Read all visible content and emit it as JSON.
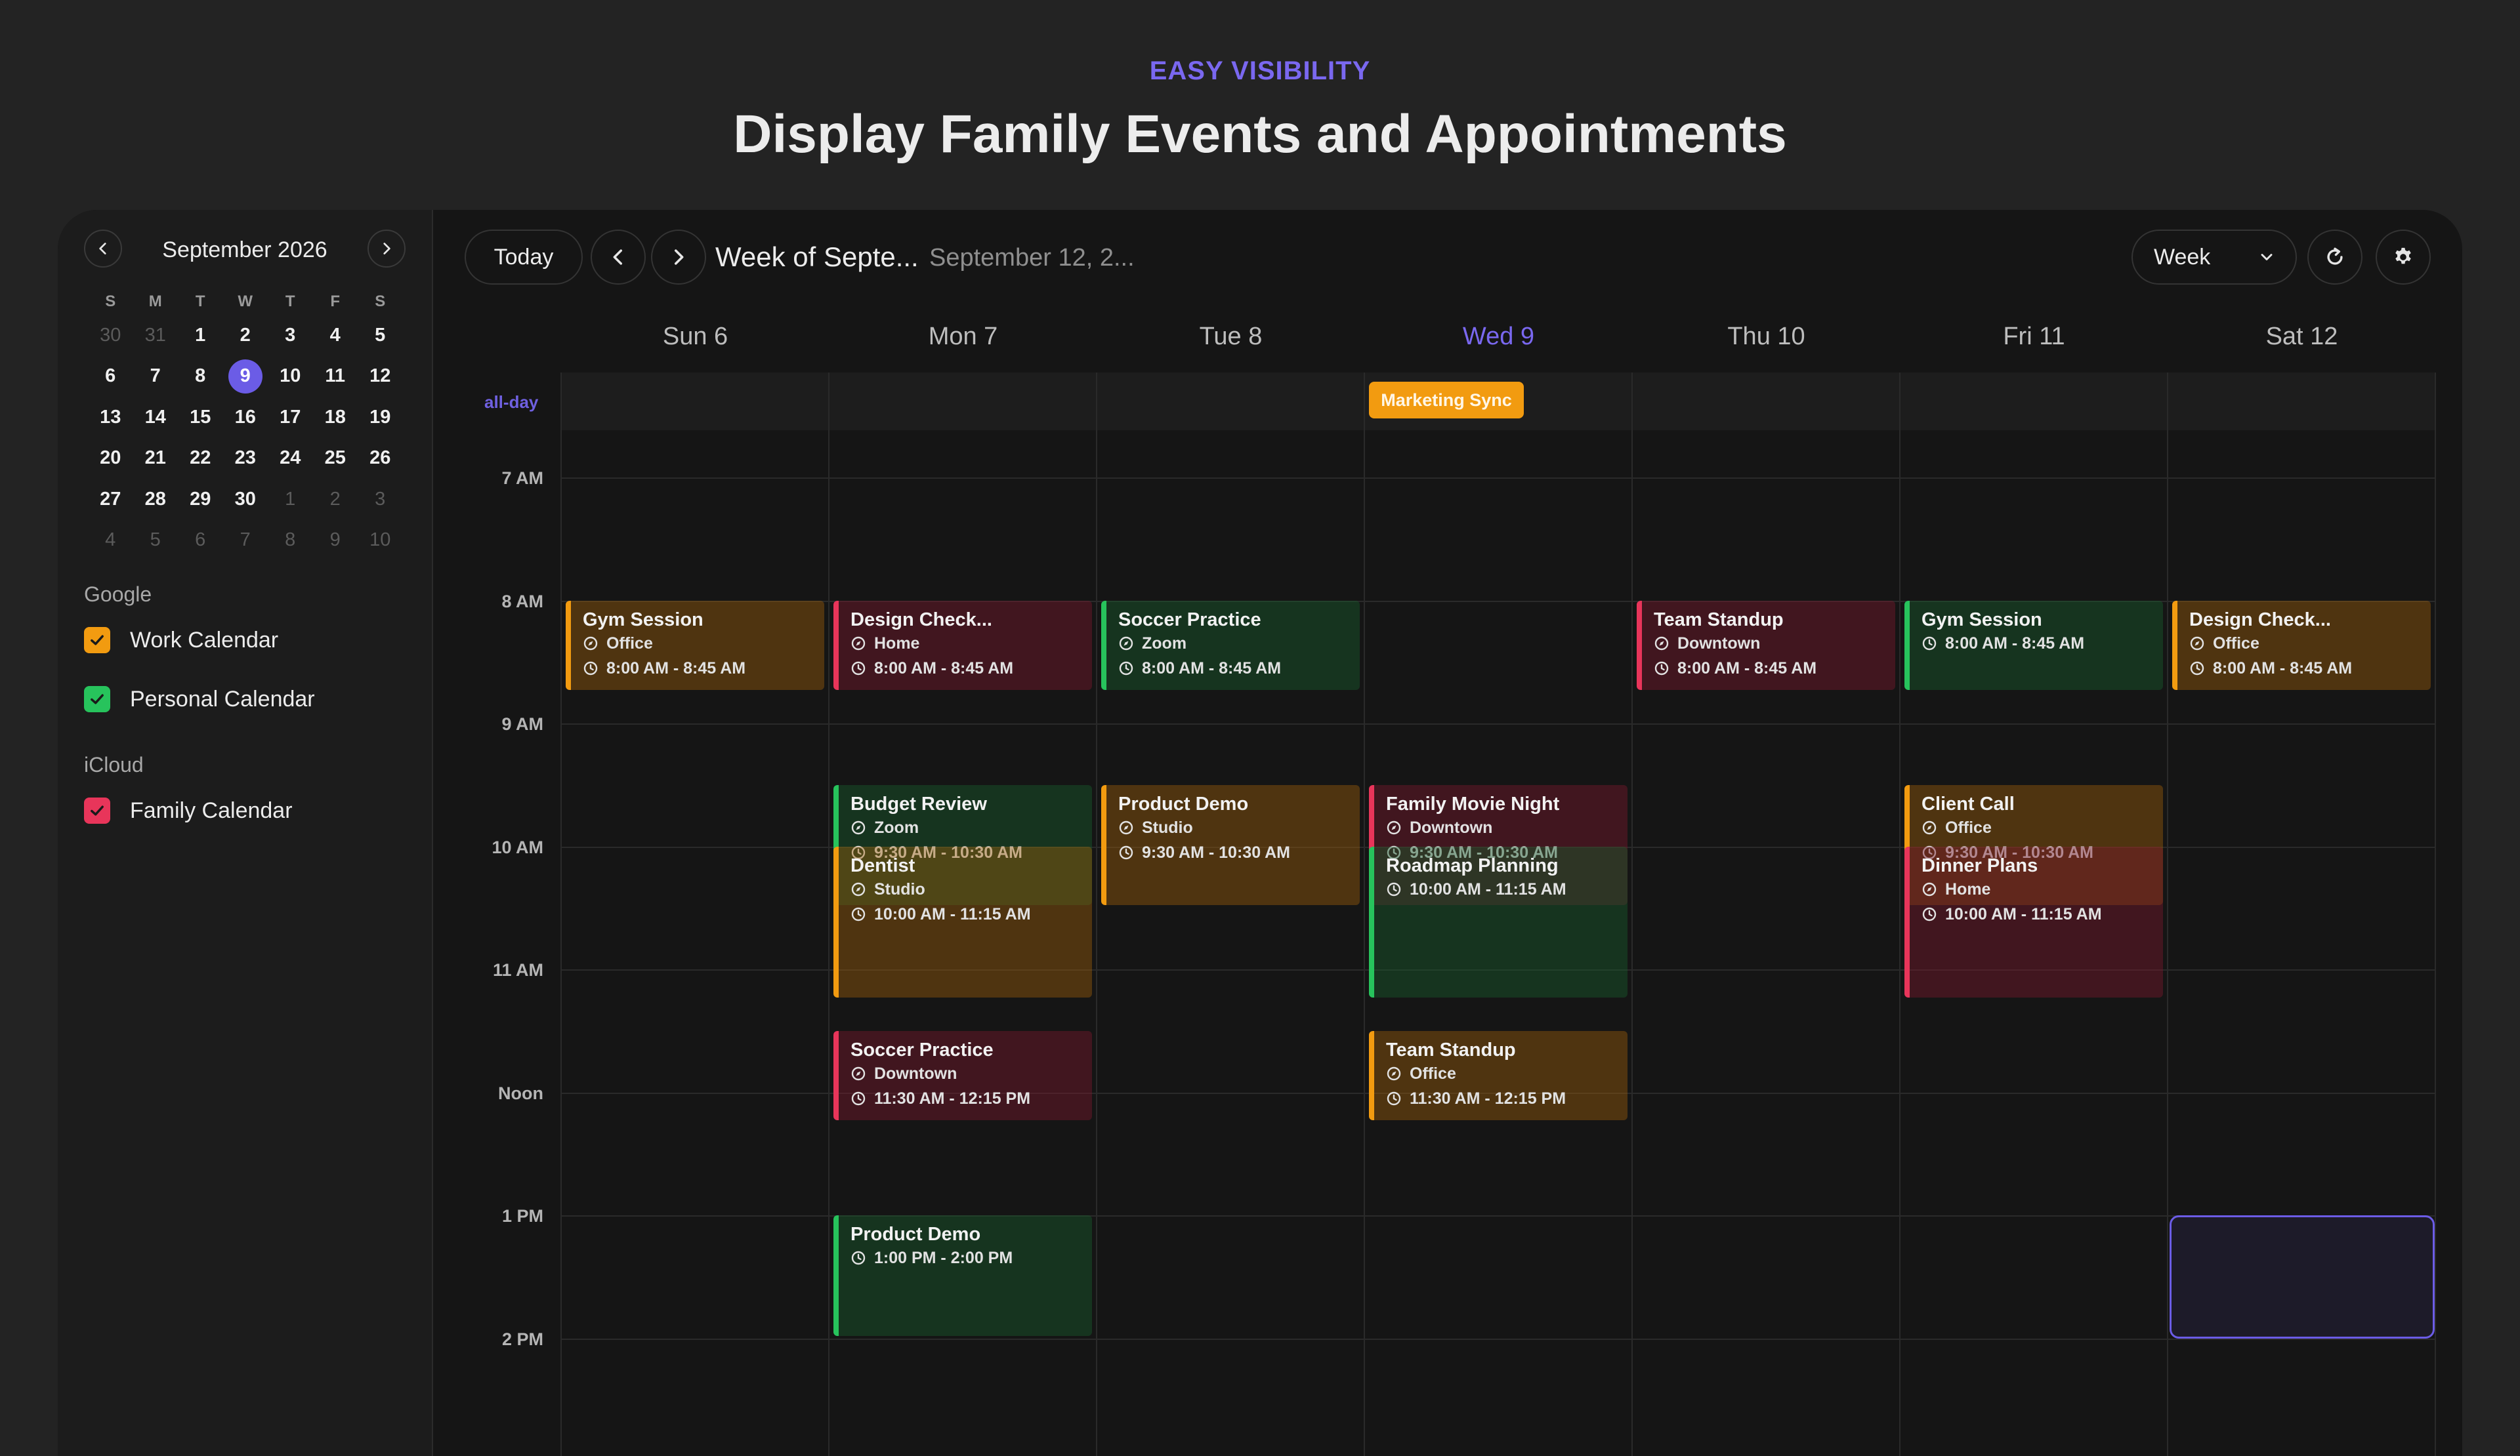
{
  "header": {
    "eyebrow": "EASY VISIBILITY",
    "headline": "Display Family Events and Appointments"
  },
  "sidebar": {
    "month_title": "September 2026",
    "weekday_initials": [
      "S",
      "M",
      "T",
      "W",
      "T",
      "F",
      "S"
    ],
    "weeks": [
      [
        "30",
        "31",
        "1",
        "2",
        "3",
        "4",
        "5"
      ],
      [
        "6",
        "7",
        "8",
        "9",
        "10",
        "11",
        "12"
      ],
      [
        "13",
        "14",
        "15",
        "16",
        "17",
        "18",
        "19"
      ],
      [
        "20",
        "21",
        "22",
        "23",
        "24",
        "25",
        "26"
      ],
      [
        "27",
        "28",
        "29",
        "30",
        "1",
        "2",
        "3"
      ],
      [
        "4",
        "5",
        "6",
        "7",
        "8",
        "9",
        "10"
      ]
    ],
    "selected_day": "9",
    "sources": [
      {
        "label": "Google",
        "calendars": [
          {
            "name": "Work Calendar",
            "color": "#f29b10",
            "checked": true
          },
          {
            "name": "Personal Calendar",
            "color": "#27c35c",
            "checked": true
          }
        ]
      },
      {
        "label": "iCloud",
        "calendars": [
          {
            "name": "Family Calendar",
            "color": "#e8355a",
            "checked": true
          }
        ]
      }
    ]
  },
  "toolbar": {
    "today_label": "Today",
    "week_title": "Week of Septe...",
    "week_subtitle": "September 12, 2...",
    "view_label": "Week"
  },
  "week": {
    "days": [
      "Sun 6",
      "Mon 7",
      "Tue 8",
      "Wed 9",
      "Thu 10",
      "Fri 11",
      "Sat 12"
    ],
    "today_index": 3,
    "allday_label": "all-day",
    "allday_events": [
      {
        "title": "Marketing Sync",
        "day": 3,
        "color": "#f29b10"
      }
    ],
    "time_labels": [
      "7 AM",
      "8 AM",
      "9 AM",
      "10 AM",
      "11 AM",
      "Noon",
      "1 PM",
      "2 PM"
    ],
    "events": [
      {
        "day": 0,
        "start": 8.0,
        "end": 8.75,
        "color": "orange",
        "title": "Gym Session",
        "location": "Office",
        "time": "8:00 AM - 8:45 AM"
      },
      {
        "day": 1,
        "start": 8.0,
        "end": 8.75,
        "color": "red",
        "title": "Design Check...",
        "location": "Home",
        "time": "8:00 AM - 8:45 AM"
      },
      {
        "day": 2,
        "start": 8.0,
        "end": 8.75,
        "color": "green",
        "title": "Soccer Practice",
        "location": "Zoom",
        "time": "8:00 AM - 8:45 AM"
      },
      {
        "day": 4,
        "start": 8.0,
        "end": 8.75,
        "color": "red",
        "title": "Team Standup",
        "location": "Downtown",
        "time": "8:00 AM - 8:45 AM"
      },
      {
        "day": 5,
        "start": 8.0,
        "end": 8.75,
        "color": "green",
        "title": "Gym Session",
        "location": "",
        "time": "8:00 AM - 8:45 AM"
      },
      {
        "day": 6,
        "start": 8.0,
        "end": 8.75,
        "color": "orange",
        "title": "Design Check...",
        "location": "Office",
        "time": "8:00 AM - 8:45 AM"
      },
      {
        "day": 1,
        "start": 9.5,
        "end": 10.5,
        "color": "green",
        "title": "Budget Review",
        "location": "Zoom",
        "time": "9:30 AM - 10:30 AM"
      },
      {
        "day": 1,
        "start": 10.0,
        "end": 11.25,
        "color": "orange",
        "title": "Dentist",
        "location": "Studio",
        "time": "10:00 AM - 11:15 AM"
      },
      {
        "day": 2,
        "start": 9.5,
        "end": 10.5,
        "color": "orange",
        "title": "Product Demo",
        "location": "Studio",
        "time": "9:30 AM - 10:30 AM"
      },
      {
        "day": 3,
        "start": 9.5,
        "end": 10.5,
        "color": "red",
        "title": "Family Movie Night",
        "location": "Downtown",
        "time": "9:30 AM - 10:30 AM"
      },
      {
        "day": 3,
        "start": 10.0,
        "end": 11.25,
        "color": "green",
        "title": "Roadmap Planning",
        "location": "",
        "time": "10:00 AM - 11:15 AM"
      },
      {
        "day": 5,
        "start": 9.5,
        "end": 10.5,
        "color": "orange",
        "title": "Client Call",
        "location": "Office",
        "time": "9:30 AM - 10:30 AM"
      },
      {
        "day": 5,
        "start": 10.0,
        "end": 11.25,
        "color": "red",
        "title": "Dinner Plans",
        "location": "Home",
        "time": "10:00 AM - 11:15 AM"
      },
      {
        "day": 1,
        "start": 11.5,
        "end": 12.25,
        "color": "red",
        "title": "Soccer Practice",
        "location": "Downtown",
        "time": "11:30 AM - 12:15 PM"
      },
      {
        "day": 3,
        "start": 11.5,
        "end": 12.25,
        "color": "orange",
        "title": "Team Standup",
        "location": "Office",
        "time": "11:30 AM - 12:15 PM"
      },
      {
        "day": 1,
        "start": 13.0,
        "end": 14.0,
        "color": "green",
        "title": "Product Demo",
        "location": "",
        "time": "1:00 PM - 2:00 PM"
      }
    ],
    "selection": {
      "day": 6,
      "start": 13.0,
      "end": 14.0
    }
  }
}
